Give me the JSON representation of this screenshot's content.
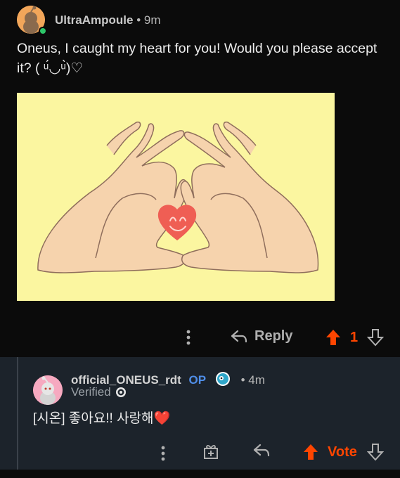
{
  "comment": {
    "username": "UltraAmpoule",
    "separator": "•",
    "time": "9m",
    "body": "Oneus, I caught my heart for you! Would you please accept it? ( ᵘ́◡ᵘ̀)♡",
    "reply_label": "Reply",
    "vote_count": "1",
    "image_caption": "hand-heart-illustration"
  },
  "reply": {
    "username": "official_ONEUS_rdt",
    "op_badge": "OP",
    "separator": "•",
    "time": "4m",
    "verified_label": "Verified",
    "body": "[시온] 좋아요!! 사랑해❤️",
    "vote_label": "Vote"
  },
  "colors": {
    "background": "#0b0b0b",
    "reply_card": "#1c232b",
    "upvote_orange": "#ff4500",
    "op_blue": "#4f8ee8",
    "online_green": "#2dc769",
    "image_bg": "#fbf6a0"
  },
  "icons": [
    "snoo-avatar-icon",
    "online-dot-icon",
    "kebab-icon",
    "reply-arrow-icon",
    "upvote-icon",
    "downvote-icon",
    "award-icon",
    "verified-badge-icon",
    "flair-emoji-icon"
  ]
}
